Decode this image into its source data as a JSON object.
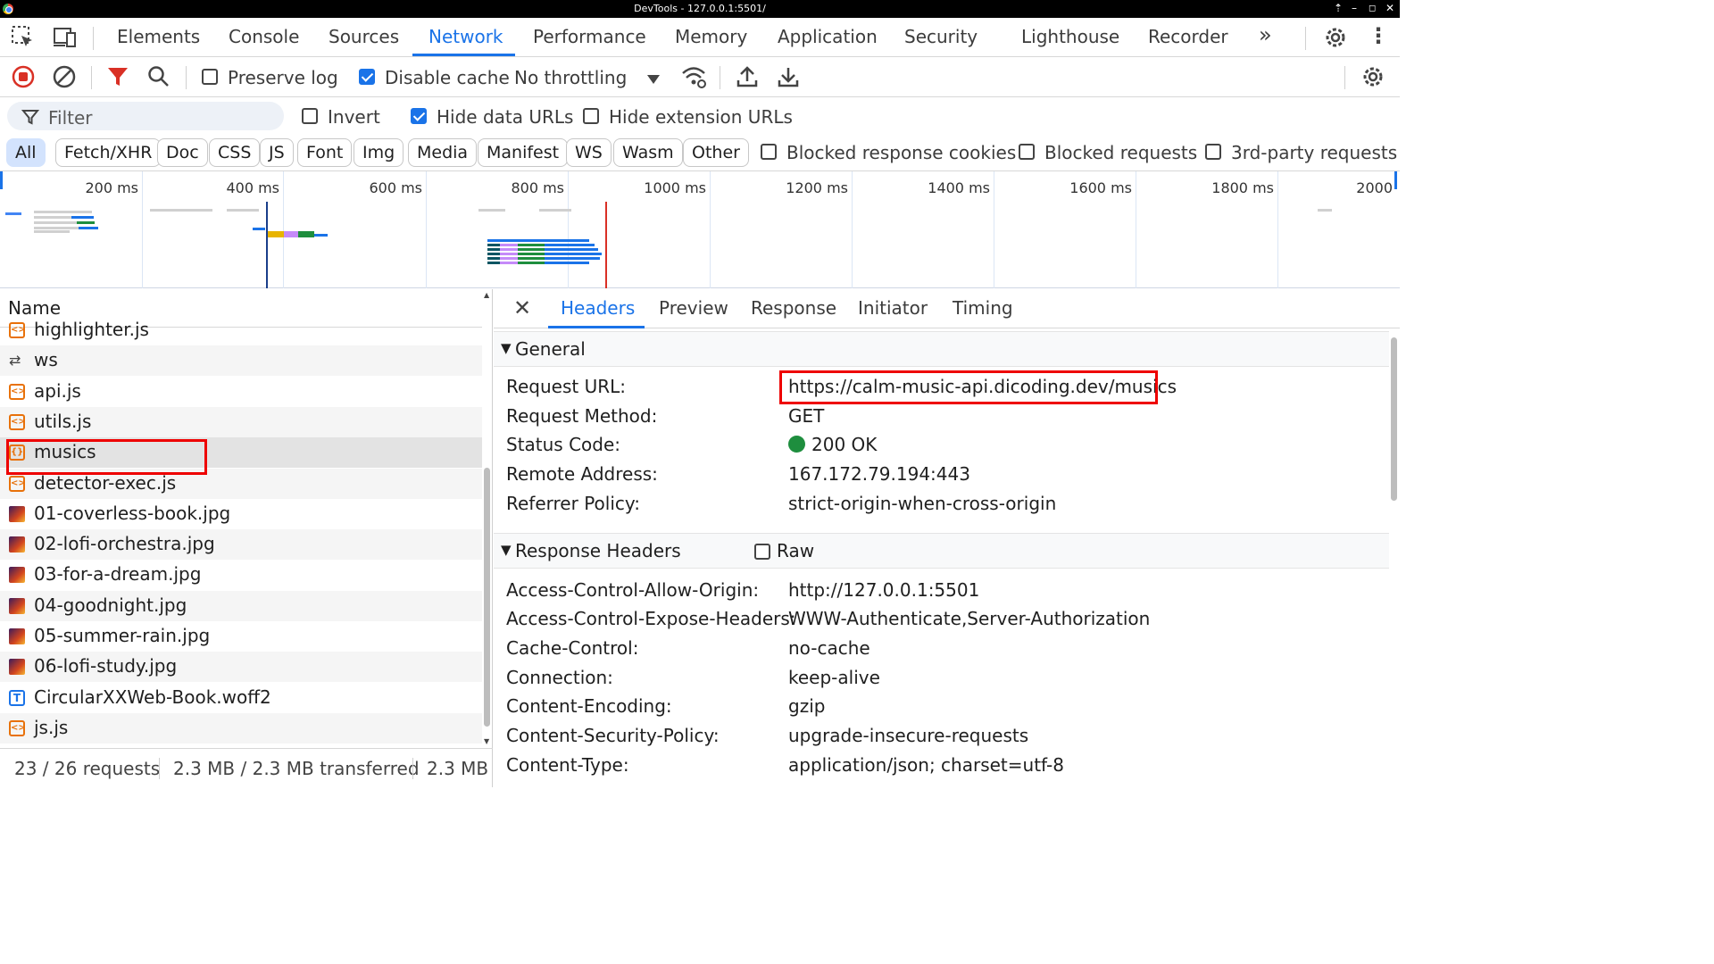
{
  "window": {
    "title": "DevTools - 127.0.0.1:5501/"
  },
  "tabs": [
    {
      "label": "Elements"
    },
    {
      "label": "Console"
    },
    {
      "label": "Sources"
    },
    {
      "label": "Network",
      "active": true
    },
    {
      "label": "Performance"
    },
    {
      "label": "Memory"
    },
    {
      "label": "Application"
    },
    {
      "label": "Security"
    },
    {
      "label": "Lighthouse"
    },
    {
      "label": "Recorder"
    }
  ],
  "toolbar": {
    "preserve_log": {
      "label": "Preserve log",
      "checked": false
    },
    "disable_cache": {
      "label": "Disable cache",
      "checked": true
    },
    "throttling": "No throttling"
  },
  "filterbar": {
    "placeholder": "Filter",
    "invert": {
      "label": "Invert",
      "checked": false
    },
    "hide_data_urls": {
      "label": "Hide data URLs",
      "checked": true
    },
    "hide_extension_urls": {
      "label": "Hide extension URLs",
      "checked": false
    }
  },
  "type_filters": [
    "All",
    "Fetch/XHR",
    "Doc",
    "CSS",
    "JS",
    "Font",
    "Img",
    "Media",
    "Manifest",
    "WS",
    "Wasm",
    "Other"
  ],
  "extra_filters": [
    {
      "label": "Blocked response cookies",
      "checked": false
    },
    {
      "label": "Blocked requests",
      "checked": false
    },
    {
      "label": "3rd-party requests",
      "checked": false
    }
  ],
  "overview": {
    "ticks": [
      "200 ms",
      "400 ms",
      "600 ms",
      "800 ms",
      "1000 ms",
      "1200 ms",
      "1400 ms",
      "1600 ms",
      "1800 ms",
      "2000"
    ]
  },
  "request_list": {
    "header": "Name",
    "rows": [
      {
        "name": "highlighter.js",
        "type": "script"
      },
      {
        "name": "ws",
        "type": "ws"
      },
      {
        "name": "api.js",
        "type": "script"
      },
      {
        "name": "utils.js",
        "type": "script"
      },
      {
        "name": "musics",
        "type": "fetch",
        "selected": true
      },
      {
        "name": "detector-exec.js",
        "type": "script"
      },
      {
        "name": "01-coverless-book.jpg",
        "type": "img"
      },
      {
        "name": "02-lofi-orchestra.jpg",
        "type": "img"
      },
      {
        "name": "03-for-a-dream.jpg",
        "type": "img"
      },
      {
        "name": "04-goodnight.jpg",
        "type": "img"
      },
      {
        "name": "05-summer-rain.jpg",
        "type": "img"
      },
      {
        "name": "06-lofi-study.jpg",
        "type": "img"
      },
      {
        "name": "CircularXXWeb-Book.woff2",
        "type": "font"
      },
      {
        "name": "js.js",
        "type": "script"
      }
    ]
  },
  "status_bar": {
    "requests": "23 / 26 requests",
    "transferred": "2.3 MB / 2.3 MB transferred",
    "resources": "2.3 MB"
  },
  "detail": {
    "tabs": [
      "Headers",
      "Preview",
      "Response",
      "Initiator",
      "Timing"
    ],
    "general": {
      "title": "General",
      "rows": [
        {
          "key": "Request URL:",
          "value": "https://calm-music-api.dicoding.dev/musics"
        },
        {
          "key": "Request Method:",
          "value": "GET"
        },
        {
          "key": "Status Code:",
          "value": "200 OK"
        },
        {
          "key": "Remote Address:",
          "value": "167.172.79.194:443"
        },
        {
          "key": "Referrer Policy:",
          "value": "strict-origin-when-cross-origin"
        }
      ]
    },
    "response_headers": {
      "title": "Response Headers",
      "raw_label": "Raw",
      "rows": [
        {
          "key": "Access-Control-Allow-Origin:",
          "value": "http://127.0.0.1:5501"
        },
        {
          "key": "Access-Control-Expose-Headers:",
          "value": "WWW-Authenticate,Server-Authorization"
        },
        {
          "key": "Cache-Control:",
          "value": "no-cache"
        },
        {
          "key": "Connection:",
          "value": "keep-alive"
        },
        {
          "key": "Content-Encoding:",
          "value": "gzip"
        },
        {
          "key": "Content-Security-Policy:",
          "value": "upgrade-insecure-requests"
        },
        {
          "key": "Content-Type:",
          "value": "application/json; charset=utf-8"
        }
      ]
    }
  },
  "colors": {
    "accent": "#1a73e8",
    "record": "#d93025",
    "filter_active": "#d93025",
    "status_ok": "#1e8e3e",
    "annotation": "#ee0000"
  }
}
